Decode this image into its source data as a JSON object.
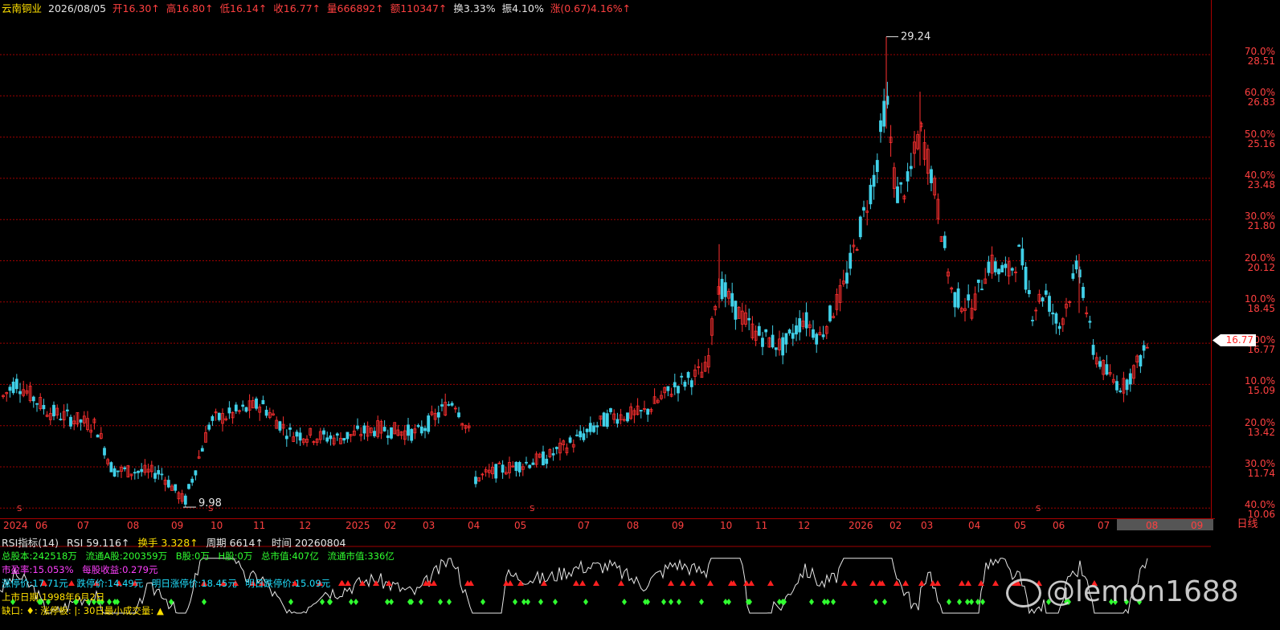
{
  "header": {
    "stock_name": "云南铜业",
    "date": "2026/08/05",
    "open": "开16.30↑",
    "high": "高16.80↑",
    "low": "低16.14↑",
    "close": "收16.77↑",
    "volume": "量666892↑",
    "amount": "额110347↑",
    "turnover": "换3.33%",
    "amplitude": "振4.10%",
    "change": "涨(0.67)4.16%↑"
  },
  "price_axis": {
    "percent_labels": [
      "70.0%",
      "60.0%",
      "50.0%",
      "40.0%",
      "30.0%",
      "20.0%",
      "10.0%",
      "0.00%",
      "10.0%",
      "20.0%",
      "30.0%",
      "40.0%"
    ],
    "price_labels": [
      "28.51",
      "26.83",
      "25.16",
      "23.48",
      "21.80",
      "20.12",
      "18.45",
      "16.77",
      "15.09",
      "13.42",
      "11.74",
      "10.06"
    ],
    "current_price": "16.77",
    "max_marker": "29.24",
    "min_marker": "9.98"
  },
  "date_axis": {
    "labels": [
      "2024",
      "06",
      "07",
      "08",
      "09",
      "10",
      "11",
      "12",
      "2025",
      "02",
      "03",
      "04",
      "05",
      "07",
      "08",
      "09",
      "10",
      "11",
      "12",
      "2026",
      "02",
      "03",
      "04",
      "05",
      "06",
      "07",
      "08",
      "09"
    ],
    "period": "日线",
    "s_marker": "S"
  },
  "rsi_panel": {
    "title": "RSI指标(14)",
    "rsi": "RSI 59.116↑",
    "turnover": "换手 3.328↑",
    "cycle": "周期 6614↑",
    "time": "时间 20260804"
  },
  "info": {
    "line1": [
      "总股本:242518万",
      "流通A股:200359万",
      "B股:0万",
      "H股:0万",
      "总市值:407亿",
      "流通市值:336亿"
    ],
    "line2": [
      "市盈率:15.053%",
      "每股收益:0.279元"
    ],
    "line3": [
      "涨停价:17.71元",
      "跌停价:14.49元",
      "明日涨停价:18.45元",
      "明日跌停价:15.09元"
    ],
    "line4": "上市日期:1998年6月2日",
    "line5": "缺口: ♦: 涨停板: |: 30日最小成交量: ▲"
  },
  "watermark": "@lemon1688",
  "colors": {
    "up": "#ff3030",
    "down": "#40d0e8",
    "grid": "#a00000",
    "label": "#ff4040"
  },
  "chart_data": {
    "type": "candlestick",
    "title": "云南铜业",
    "x": [
      "2024",
      "06",
      "07",
      "08",
      "09",
      "10",
      "11",
      "12",
      "2025",
      "02",
      "03",
      "04",
      "05",
      "07",
      "08",
      "09",
      "10",
      "11",
      "12",
      "2026",
      "02",
      "03",
      "04",
      "05",
      "06",
      "07",
      "08",
      "09"
    ],
    "close_trend": [
      14.7,
      13.8,
      13.3,
      11.2,
      10.5,
      13.9,
      14.0,
      13.1,
      12.8,
      13.2,
      13.5,
      11.3,
      11.8,
      12.9,
      13.9,
      15.2,
      18.0,
      17.0,
      18.4,
      21.6,
      25.6,
      24.0,
      18.4,
      19.2,
      17.6,
      15.6,
      16.77,
      null
    ],
    "ylim": [
      10.06,
      29.24
    ],
    "max": 29.24,
    "min": 9.98,
    "rsi_last": 59.116
  }
}
